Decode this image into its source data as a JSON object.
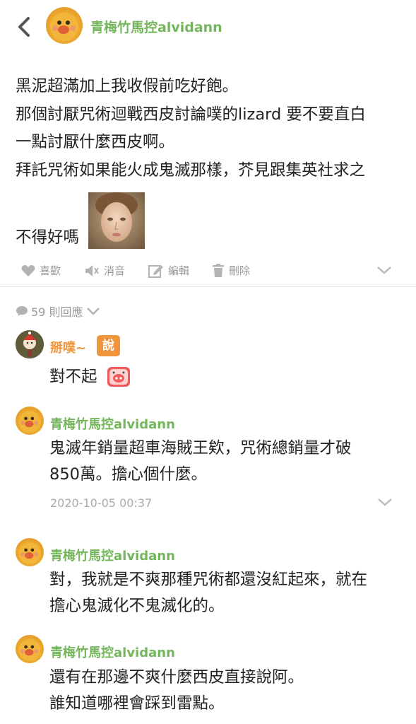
{
  "header": {
    "back_icon": "chevron-left-icon",
    "username": "青梅竹馬控alvidann"
  },
  "post": {
    "lines": [
      "黑泥超滿加上我收假前吃好飽。",
      "那個討厭咒術迴戰西皮討論噗的lizard 要不要直白",
      "一點討厭什麼西皮啊。",
      "拜託咒術如果能火成鬼滅那樣，芥見跟集英社求之",
      "不得好嗎"
    ],
    "actions": {
      "like": "喜歡",
      "mute": "消音",
      "edit": "編輯",
      "delete": "刪除"
    }
  },
  "replies_header": {
    "count": "59 則回應"
  },
  "replies": [
    {
      "username": "掰噗~",
      "badge": "說",
      "text": "對不起"
    },
    {
      "username": "青梅竹馬控alvidann",
      "lines": [
        "鬼滅年銷量超車海賊王欸，咒術總銷量才破",
        "850萬。擔心個什麼。"
      ],
      "timestamp": "2020-10-05 00:37"
    },
    {
      "username": "青梅竹馬控alvidann",
      "lines": [
        "對，我就是不爽那種咒術都還沒紅起來，就在",
        "擔心鬼滅化不鬼滅化的。"
      ]
    },
    {
      "username": "青梅竹馬控alvidann",
      "lines": [
        "還有在那邊不爽什麼西皮直接說阿。",
        "誰知道哪裡會踩到雷點。"
      ]
    }
  ],
  "colors": {
    "username": "#74b65c",
    "badge": "#f0953b",
    "meta": "#999999"
  }
}
